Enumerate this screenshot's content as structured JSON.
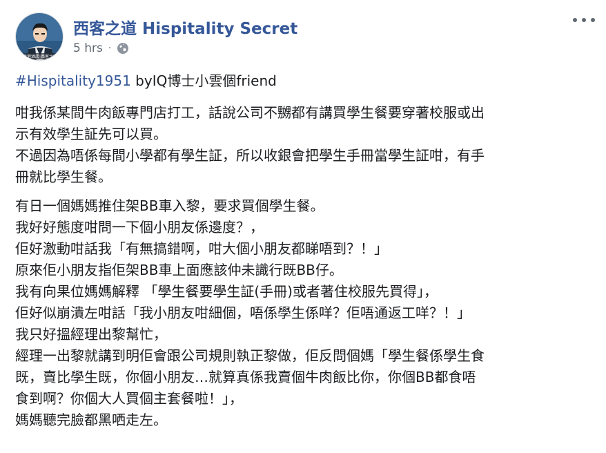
{
  "post": {
    "page_name": "西客之道 Hispitality Secret",
    "timestamp": "5 hrs",
    "separator": "·",
    "privacy_icon": "globe-icon",
    "more_icon": "more-options-icon",
    "avatar_caption": "香港酒店 西客之道",
    "accent_color": "#365899",
    "hashtag": "#Hispitality1951",
    "title_suffix": " byIQ博士小雲個friend",
    "paragraph1": [
      "咁我係某間牛肉飯專門店打工，話說公司不嬲都有講買學生餐要穿著校服或出",
      "示有效學生証先可以買。",
      "不過因為唔係每間小學都有學生証，所以收銀會把學生手冊當學生証咁，有手",
      "冊就比學生餐。"
    ],
    "paragraph2": [
      "有日一個媽媽推住架BB車入黎，要求買個學生餐。",
      "我好好態度咁問一下個小朋友係邊度？，",
      "佢好激動咁話我「有無搞錯啊，咁大個小朋友都睇唔到？！」",
      "原來佢小朋友指佢架BB車上面應該仲未識行既BB仔。",
      "我有向果位媽媽解釋 「學生餐要學生証(手冊)或者著住校服先買得」，",
      "佢好似崩潰左咁話「我小朋友咁細個，唔係學生係咩？佢唔通返工咩？！」",
      "我只好搵經理出黎幫忙，",
      "經理一出黎就講到明佢會跟公司規則執正黎做，佢反問個媽「學生餐係學生食",
      "既，賣比學生既，你個小朋友…就算真係我賣個牛肉飯比你，你個BB都食唔",
      "食到啊？你個大人買個主套餐啦！」，",
      "媽媽聽完臉都黑哂走左。"
    ]
  }
}
